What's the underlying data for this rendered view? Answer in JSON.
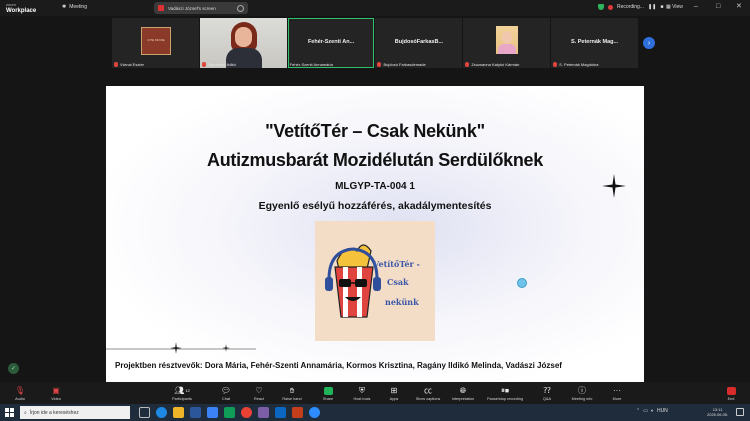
{
  "app": {
    "brand_small": "zoom",
    "brand_big": "Workplace",
    "meeting_label": "Meeting",
    "share_banner": "Vadászi József's screen",
    "recording_label": "Recording...",
    "view_label": "View"
  },
  "participants": [
    {
      "name": "Várnai Eszter",
      "center_name": "",
      "logo_text": "CITE MOVIE"
    },
    {
      "name": "Germenin Ildikó",
      "center_name": ""
    },
    {
      "name": "Fehér-Szenti Annamária",
      "center_name": "Fehér-Szenti An...",
      "active": true
    },
    {
      "name": "Bujdosó Farkasdemade",
      "center_name": "BujdosóFarkasB..."
    },
    {
      "name": "Zsuzsanna Katykó Kármán",
      "center_name": ""
    },
    {
      "name": "S. Petemák Magdolna",
      "center_name": "S. Peternák Mag..."
    }
  ],
  "slide": {
    "title_line1": "\"VetítőTér – Csak Nekünk\"",
    "title_line2": "Autizmusbarát Mozidélután Serdülőknek",
    "code": "MLGYP-TA-004 1",
    "subtitle": "Egyenlő esélyű hozzáférés, akadálymentesítés",
    "logo_line1": "VetítőTér -",
    "logo_line2": "Csak",
    "logo_line3": "nekünk",
    "credits": "Projektben résztvevők: Dora Mária, Fehér-Szenti Annamária, Kormos Krisztina, Ragány Ildikó Melinda, Vadászi József"
  },
  "toolbar": {
    "audio": "Audio",
    "video": "Video",
    "participants": "Participants",
    "participants_count": "12",
    "chat": "Chat",
    "react": "React",
    "raise_hand": "Raise hand",
    "share": "Share",
    "host_tools": "Host tools",
    "apps": "Apps",
    "show_captions": "Show captions",
    "interpretation": "Interpretation",
    "pause_recording": "Pause/stop recording",
    "qa": "Q&A",
    "meeting_info": "Meeting info",
    "more": "More",
    "end": "End"
  },
  "taskbar": {
    "search_placeholder": "Írjon ide a kereséshez",
    "language": "HUN",
    "time": "13:11",
    "date": "2025.06.05."
  },
  "colors": {
    "active_border": "#2ec26b",
    "share_green": "#22b45a",
    "end_red": "#d82c2c",
    "logo_text_blue": "#3b56a8",
    "poster_bg": "#f3ddc6"
  }
}
